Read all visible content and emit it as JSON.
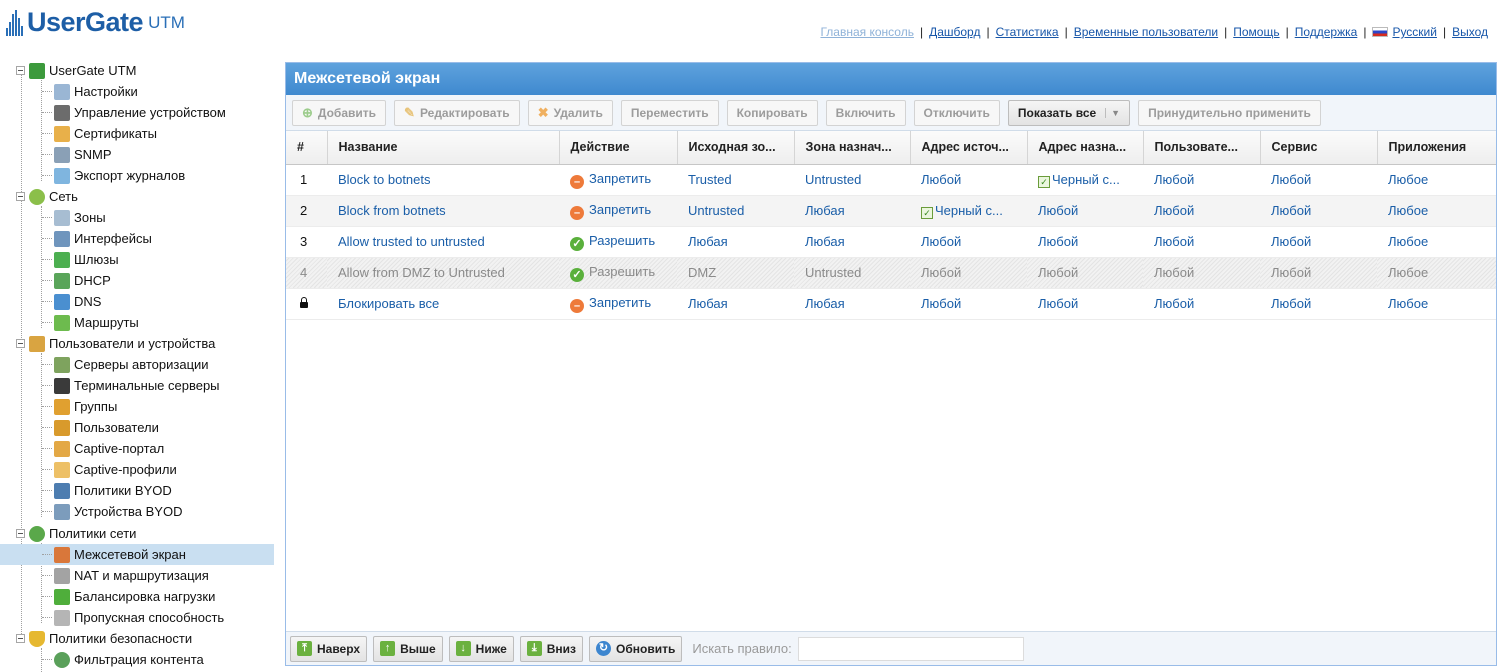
{
  "app": {
    "logo": "UserGate",
    "logo_suffix": "UTM"
  },
  "colors": {
    "accent": "#3f89cf",
    "link": "#1756a9",
    "deny": "#ee7a3a",
    "allow": "#5ab03c",
    "selected": "#c9dff1"
  },
  "toplinks": {
    "main_console": "Главная консоль",
    "dashboard": "Дашборд",
    "statistics": "Статистика",
    "temp_users": "Временные пользователи",
    "help": "Помощь",
    "support": "Поддержка",
    "language": "Русский",
    "logout": "Выход"
  },
  "tree": {
    "root": "UserGate UTM",
    "settings": "Настройки",
    "device_mgmt": "Управление устройством",
    "certificates": "Сертификаты",
    "snmp": "SNMP",
    "log_export": "Экспорт журналов",
    "network": "Сеть",
    "zones": "Зоны",
    "interfaces": "Интерфейсы",
    "gateways": "Шлюзы",
    "dhcp": "DHCP",
    "dns": "DNS",
    "routes": "Маршруты",
    "users_devices": "Пользователи и устройства",
    "auth_servers": "Серверы авторизации",
    "terminal_servers": "Терминальные серверы",
    "groups": "Группы",
    "users": "Пользователи",
    "captive_portal": "Captive-портал",
    "captive_profiles": "Captive-профили",
    "byod_policies": "Политики BYOD",
    "byod_devices": "Устройства BYOD",
    "net_policies": "Политики сети",
    "firewall": "Межсетевой экран",
    "nat_routing": "NAT и маршрутизация",
    "load_balancing": "Балансировка нагрузки",
    "bandwidth": "Пропускная способность",
    "security_policies": "Политики безопасности",
    "content_filtering": "Фильтрация контента"
  },
  "panel": {
    "title": "Межсетевой экран"
  },
  "toolbar": {
    "add": "Добавить",
    "edit": "Редактировать",
    "delete": "Удалить",
    "move": "Переместить",
    "copy": "Копировать",
    "enable": "Включить",
    "disable": "Отключить",
    "show_all": "Показать все",
    "force_apply": "Принудительно применить"
  },
  "columns": {
    "num": "#",
    "name": "Название",
    "action": "Действие",
    "src_zone": "Исходная зо...",
    "dst_zone": "Зона назнач...",
    "src_addr": "Адрес источ...",
    "dst_addr": "Адрес назна...",
    "users": "Пользовате...",
    "service": "Сервис",
    "apps": "Приложения"
  },
  "rows": [
    {
      "num": "1",
      "name": "Block to botnets",
      "action": "Запретить",
      "action_type": "deny",
      "src_zone": "Trusted",
      "dst_zone": "Untrusted",
      "src_addr": "Любой",
      "dst_addr": "Черный с...",
      "users": "Любой",
      "service": "Любой",
      "apps": "Любое"
    },
    {
      "num": "2",
      "name": "Block from botnets",
      "action": "Запретить",
      "action_type": "deny",
      "src_zone": "Untrusted",
      "dst_zone": "Любая",
      "src_addr": "Черный с...",
      "dst_addr": "Любой",
      "users": "Любой",
      "service": "Любой",
      "apps": "Любое"
    },
    {
      "num": "3",
      "name": "Allow trusted to untrusted",
      "action": "Разрешить",
      "action_type": "allow",
      "src_zone": "Любая",
      "dst_zone": "Любая",
      "src_addr": "Любой",
      "dst_addr": "Любой",
      "users": "Любой",
      "service": "Любой",
      "apps": "Любое"
    },
    {
      "num": "4",
      "name": "Allow from DMZ to Untrusted",
      "action": "Разрешить",
      "action_type": "allow",
      "src_zone": "DMZ",
      "dst_zone": "Untrusted",
      "src_addr": "Любой",
      "dst_addr": "Любой",
      "users": "Любой",
      "service": "Любой",
      "apps": "Любое",
      "disabled": true
    },
    {
      "num": "",
      "name": "Блокировать все",
      "action": "Запретить",
      "action_type": "deny",
      "src_zone": "Любая",
      "dst_zone": "Любая",
      "src_addr": "Любой",
      "dst_addr": "Любой",
      "users": "Любой",
      "service": "Любой",
      "apps": "Любое",
      "locked": true
    }
  ],
  "bottombar": {
    "top": "Наверх",
    "up": "Выше",
    "down": "Ниже",
    "bottom": "Вниз",
    "refresh": "Обновить",
    "search_label": "Искать правило:",
    "search_value": ""
  }
}
